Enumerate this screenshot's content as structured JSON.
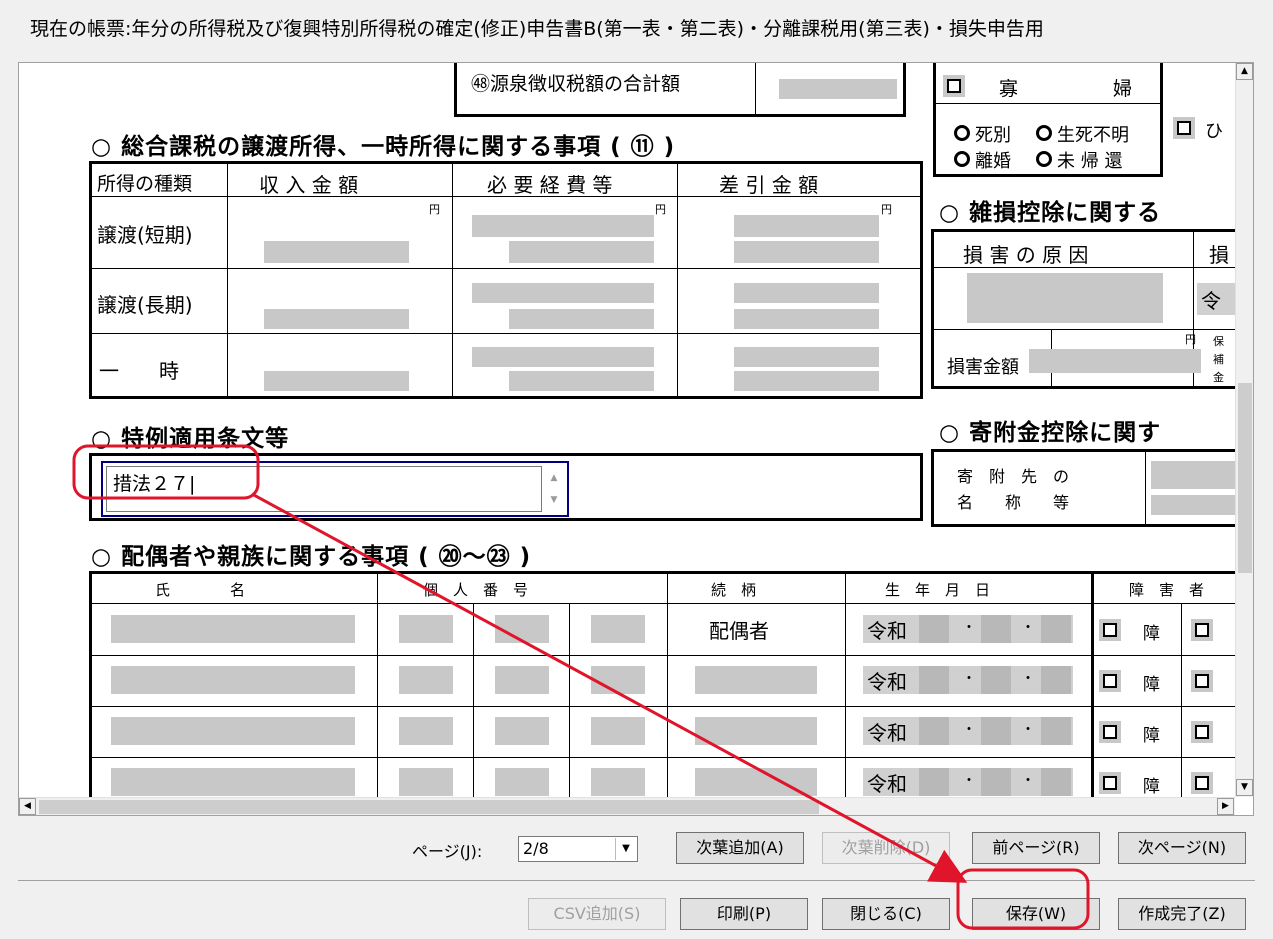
{
  "header": {
    "title": "現在の帳票:年分の所得税及び復興特別所得税の確定(修正)申告書B(第一表・第二表)・分離課税用(第三表)・損失申告用"
  },
  "form": {
    "withholding_total": "㊽源泉徴収税額の合計額",
    "widow": {
      "label1": "寡",
      "label2": "婦",
      "options": [
        "死別",
        "生死不明",
        "離婚",
        "未 帰 還"
      ],
      "hi": "ひ"
    },
    "transfer_section": {
      "title": "○ 総合課税の譲渡所得、一時所得に関する事項 ( ⑪ )",
      "headers": [
        "所得の種類",
        "収 入 金 額",
        "必 要 経 費 等",
        "差 引 金 額"
      ],
      "rows": [
        "譲渡(短期)",
        "譲渡(長期)",
        "一　　時"
      ],
      "yen": "円"
    },
    "casualty_section": {
      "title": "○ 雑損控除に関する",
      "cause": "損 害 の 原 因",
      "cause2": "損",
      "era": "令",
      "amount": "損害金額",
      "yen": "円",
      "insurance": [
        "保",
        "補",
        "金"
      ]
    },
    "special_section": {
      "title": "○ 特例適用条文等",
      "value": "措法２７|"
    },
    "donation_section": {
      "title": "○ 寄附金控除に関す",
      "label": [
        "寄　附　先　の",
        "名　　称　　等"
      ]
    },
    "family_section": {
      "title": "○ 配偶者や親族に関する事項 ( ⑳〜㉓ )",
      "headers": [
        "氏　　　　名",
        "個　人　番　号",
        "続　柄",
        "生　年　月　日",
        "障　害　者"
      ],
      "relation_first": "配偶者",
      "era": "令和",
      "dot": "・",
      "disabled": "障"
    }
  },
  "footer": {
    "page_label": "ページ(J):",
    "page_value": "2/8",
    "buttons_row1": [
      "次葉追加(A)",
      "次葉削除(D)",
      "前ページ(R)",
      "次ページ(N)"
    ],
    "buttons_row2": [
      "CSV追加(S)",
      "印刷(P)",
      "閉じる(C)",
      "保存(W)",
      "作成完了(Z)"
    ]
  },
  "annotation_color": "#e0142a"
}
